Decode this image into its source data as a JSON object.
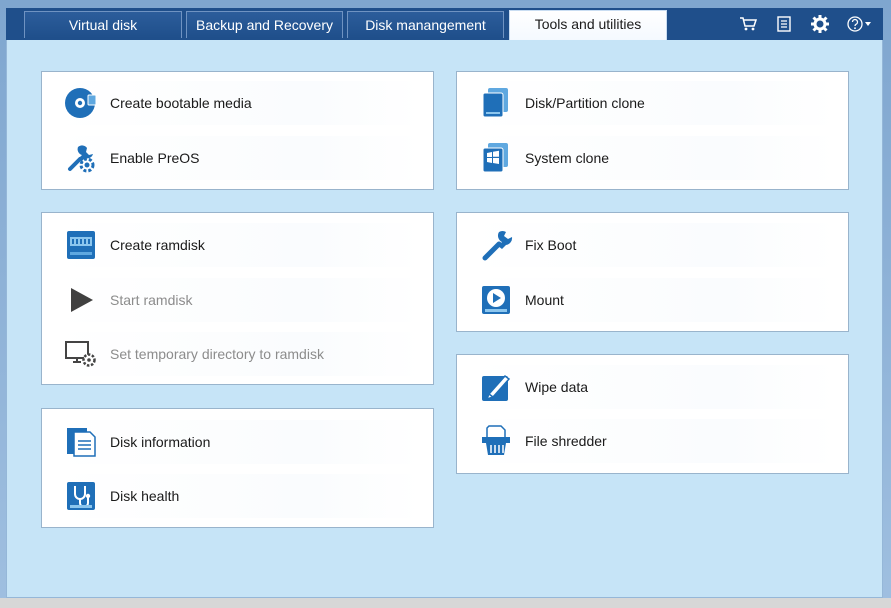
{
  "tabs": [
    {
      "label": "Virtual disk"
    },
    {
      "label": "Backup and Recovery"
    },
    {
      "label": "Disk manangement"
    },
    {
      "label": "Tools and utilities",
      "active": true
    }
  ],
  "top_icons": [
    "cart-icon",
    "list-icon",
    "gear-icon",
    "help-icon"
  ],
  "panels": {
    "bootable": [
      {
        "label": "Create bootable media",
        "icon": "disc-icon"
      },
      {
        "label": "Enable PreOS",
        "icon": "wrench-gear-icon"
      }
    ],
    "ramdisk": [
      {
        "label": "Create ramdisk",
        "icon": "ramdisk-icon"
      },
      {
        "label": "Start ramdisk",
        "icon": "play-icon",
        "disabled": true
      },
      {
        "label": "Set temporary directory to ramdisk",
        "icon": "monitor-gear-icon",
        "disabled": true
      }
    ],
    "diskinfo": [
      {
        "label": "Disk information",
        "icon": "document-icon"
      },
      {
        "label": "Disk health",
        "icon": "stethoscope-icon"
      }
    ],
    "clone": [
      {
        "label": "Disk/Partition clone",
        "icon": "disk-clone-icon"
      },
      {
        "label": "System clone",
        "icon": "system-clone-icon"
      }
    ],
    "fix": [
      {
        "label": "Fix Boot",
        "icon": "wrench-icon"
      },
      {
        "label": "Mount",
        "icon": "mount-icon"
      }
    ],
    "wipe": [
      {
        "label": "Wipe data",
        "icon": "wipe-icon"
      },
      {
        "label": "File shredder",
        "icon": "shredder-icon"
      }
    ]
  },
  "colors": {
    "accent": "#1f6fb8",
    "tabbar": "#1f4f8b",
    "content_bg": "#c6e4f7",
    "disabled_text": "#8c8c8c"
  }
}
